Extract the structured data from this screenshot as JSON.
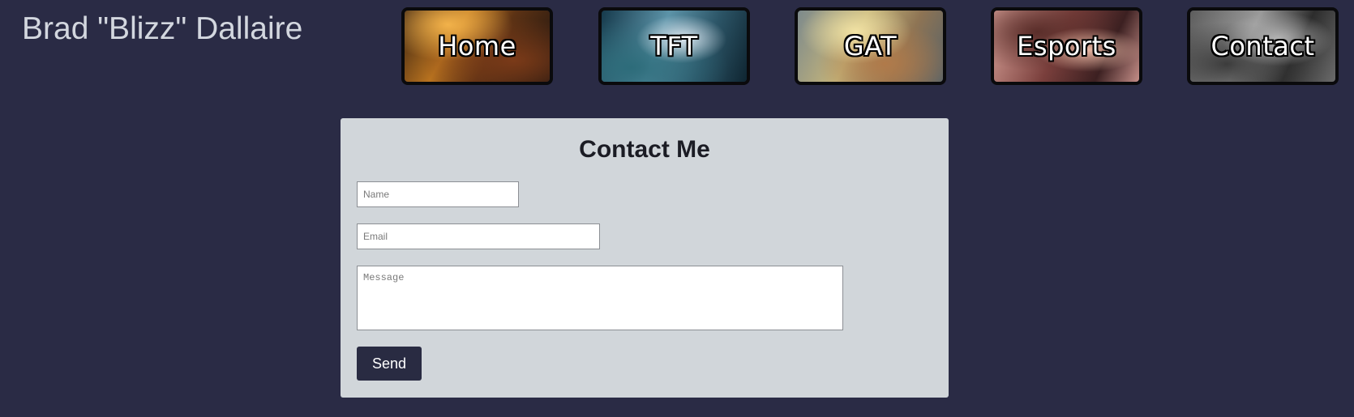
{
  "header": {
    "site_title": "Brad \"Blizz\" Dallaire"
  },
  "nav": {
    "items": [
      {
        "label": "Home"
      },
      {
        "label": "TFT"
      },
      {
        "label": "GAT"
      },
      {
        "label": "Esports"
      },
      {
        "label": "Contact"
      }
    ]
  },
  "contact_form": {
    "title": "Contact Me",
    "name_placeholder": "Name",
    "name_value": "",
    "email_placeholder": "Email",
    "email_value": "",
    "message_placeholder": "Message",
    "message_value": "",
    "send_label": "Send"
  },
  "colors": {
    "page_background": "#2a2b45",
    "card_background": "#d1d6da",
    "button_background": "#292b42",
    "title_text": "#d3d7df"
  }
}
